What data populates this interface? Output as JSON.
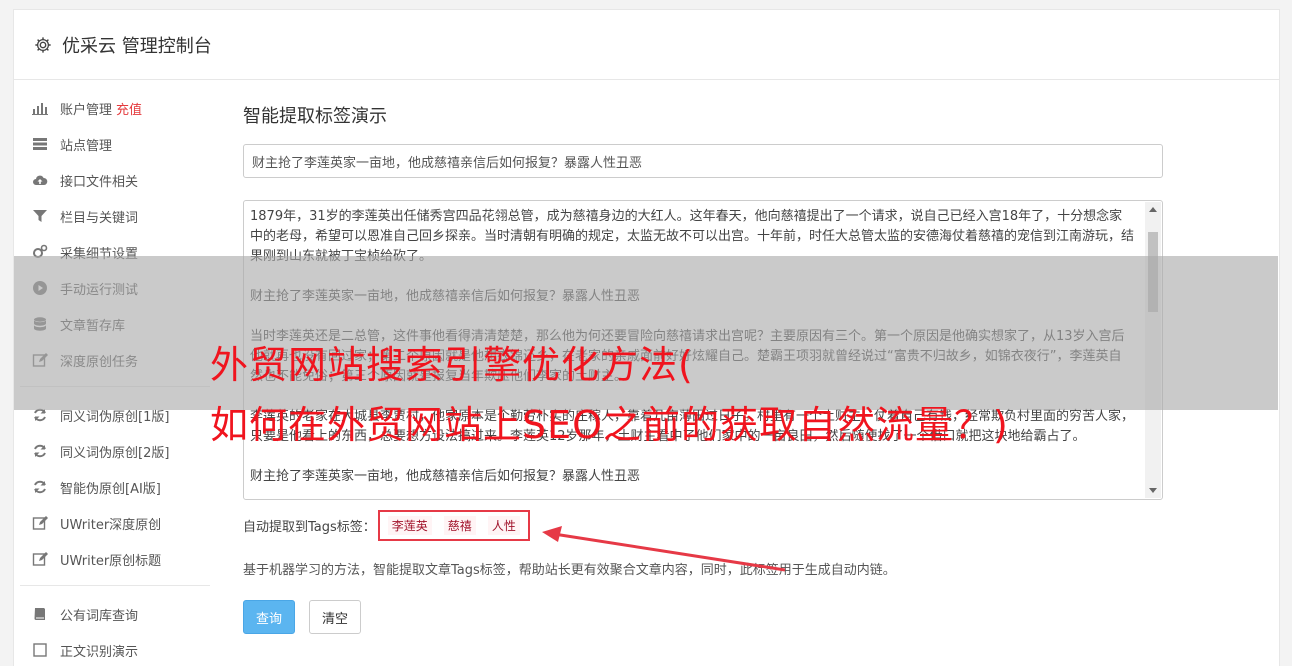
{
  "header": {
    "title": "优采云 管理控制台"
  },
  "sidebar": {
    "groups": [
      [
        {
          "label": "账户管理",
          "badge": "充值",
          "icon": "bar-chart-icon"
        },
        {
          "label": "站点管理",
          "icon": "server-icon"
        },
        {
          "label": "接口文件相关",
          "icon": "cloud-upload-icon"
        },
        {
          "label": "栏目与关键词",
          "icon": "filter-icon"
        },
        {
          "label": "采集细节设置",
          "icon": "gears-icon"
        },
        {
          "label": "手动运行测试",
          "icon": "play-icon"
        },
        {
          "label": "文章暂存库",
          "icon": "database-icon"
        },
        {
          "label": "深度原创任务",
          "icon": "edit-icon"
        }
      ],
      [
        {
          "label": "同义词伪原创[1版]",
          "icon": "refresh-icon"
        },
        {
          "label": "同义词伪原创[2版]",
          "icon": "refresh-icon"
        },
        {
          "label": "智能伪原创[AI版]",
          "icon": "refresh-icon"
        },
        {
          "label": "UWriter深度原创",
          "icon": "edit-icon"
        },
        {
          "label": "UWriter原创标题",
          "icon": "edit-icon"
        }
      ],
      [
        {
          "label": "公有词库查询",
          "icon": "book-icon"
        },
        {
          "label": "正文识别演示",
          "icon": "file-icon"
        }
      ]
    ]
  },
  "main": {
    "section_title": "智能提取标签演示",
    "title_value": "财主抢了李莲英家一亩地，他成慈禧亲信后如何报复？暴露人性丑恶",
    "article_paragraphs": [
      "1879年，31岁的李莲英出任储秀宫四品花翎总管，成为慈禧身边的大红人。这年春天，他向慈禧提出了一个请求，说自己已经入宫18年了，十分想念家中的老母，希望可以恩准自己回乡探亲。当时清朝有明确的规定，太监无故不可以出宫。十年前，时任大总管太监的安德海仗着慈禧的宠信到江南游玩，结果刚到山东就被丁宝桢给砍了。",
      "财主抢了李莲英家一亩地，他成慈禧亲信后如何报复？暴露人性丑恶",
      "当时李莲英还是二总管，这件事他看得清清楚楚，那么他为何还要冒险向慈禧请求出宫呢？主要原因有三个。第一个原因是他确实想家了，从13岁入宫后他就再也没有回过家；第二个原因就是他想衣锦还乡，在老家的亲戚面前好好炫耀自己。楚霸王项羽就曾经说过“富贵不归故乡，如锦衣夜行”，李莲英自然也不能免俗；第三个原因就是报复当年欺压他们李家的土财主。",
      "李莲英的老家在大城县李贾村，他家原本是个勤劳朴实的庄稼人，靠着几亩薄田过日子。村里有一个土财主，仗着自己有钱，经常欺负村里面的穷苦人家，只要是他看上的东西，总要想方设法搞过来。李莲英12岁那年，土财主看中了他们家中的一亩良田，然后随便找了一个借口就把这块地给霸占了。",
      "财主抢了李莲英家一亩地，他成慈禧亲信后如何报复？暴露人性丑恶"
    ],
    "tags_label": "自动提取到Tags标签：",
    "tags": [
      "李莲英",
      "慈禧",
      "人性"
    ],
    "description": "基于机器学习的方法，智能提取文章Tags标签，帮助站长更有效聚合文章内容，同时，此标签用于生成自动内链。",
    "query_button": "查询",
    "clear_button": "清空"
  },
  "overlay": {
    "line1": "外贸网站搜索引擎优化方法(",
    "line2": "如何在外贸网站上SEO之前的获取自然流量？)"
  },
  "colors": {
    "overlay_text": "#f0141e",
    "primary_button": "#5bb5f0",
    "badge": "#e4393c",
    "tag_border": "#e63946"
  }
}
